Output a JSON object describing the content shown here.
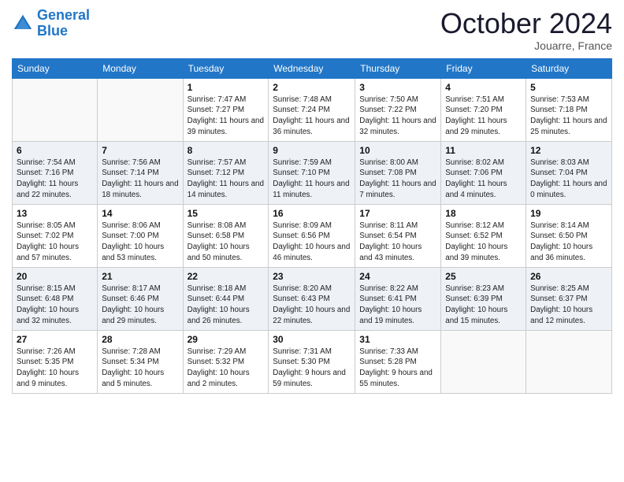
{
  "header": {
    "logo_line1": "General",
    "logo_line2": "Blue",
    "month": "October 2024",
    "location": "Jouarre, France"
  },
  "days_of_week": [
    "Sunday",
    "Monday",
    "Tuesday",
    "Wednesday",
    "Thursday",
    "Friday",
    "Saturday"
  ],
  "weeks": [
    [
      {
        "day": "",
        "sunrise": "",
        "sunset": "",
        "daylight": ""
      },
      {
        "day": "",
        "sunrise": "",
        "sunset": "",
        "daylight": ""
      },
      {
        "day": "1",
        "sunrise": "Sunrise: 7:47 AM",
        "sunset": "Sunset: 7:27 PM",
        "daylight": "Daylight: 11 hours and 39 minutes."
      },
      {
        "day": "2",
        "sunrise": "Sunrise: 7:48 AM",
        "sunset": "Sunset: 7:24 PM",
        "daylight": "Daylight: 11 hours and 36 minutes."
      },
      {
        "day": "3",
        "sunrise": "Sunrise: 7:50 AM",
        "sunset": "Sunset: 7:22 PM",
        "daylight": "Daylight: 11 hours and 32 minutes."
      },
      {
        "day": "4",
        "sunrise": "Sunrise: 7:51 AM",
        "sunset": "Sunset: 7:20 PM",
        "daylight": "Daylight: 11 hours and 29 minutes."
      },
      {
        "day": "5",
        "sunrise": "Sunrise: 7:53 AM",
        "sunset": "Sunset: 7:18 PM",
        "daylight": "Daylight: 11 hours and 25 minutes."
      }
    ],
    [
      {
        "day": "6",
        "sunrise": "Sunrise: 7:54 AM",
        "sunset": "Sunset: 7:16 PM",
        "daylight": "Daylight: 11 hours and 22 minutes."
      },
      {
        "day": "7",
        "sunrise": "Sunrise: 7:56 AM",
        "sunset": "Sunset: 7:14 PM",
        "daylight": "Daylight: 11 hours and 18 minutes."
      },
      {
        "day": "8",
        "sunrise": "Sunrise: 7:57 AM",
        "sunset": "Sunset: 7:12 PM",
        "daylight": "Daylight: 11 hours and 14 minutes."
      },
      {
        "day": "9",
        "sunrise": "Sunrise: 7:59 AM",
        "sunset": "Sunset: 7:10 PM",
        "daylight": "Daylight: 11 hours and 11 minutes."
      },
      {
        "day": "10",
        "sunrise": "Sunrise: 8:00 AM",
        "sunset": "Sunset: 7:08 PM",
        "daylight": "Daylight: 11 hours and 7 minutes."
      },
      {
        "day": "11",
        "sunrise": "Sunrise: 8:02 AM",
        "sunset": "Sunset: 7:06 PM",
        "daylight": "Daylight: 11 hours and 4 minutes."
      },
      {
        "day": "12",
        "sunrise": "Sunrise: 8:03 AM",
        "sunset": "Sunset: 7:04 PM",
        "daylight": "Daylight: 11 hours and 0 minutes."
      }
    ],
    [
      {
        "day": "13",
        "sunrise": "Sunrise: 8:05 AM",
        "sunset": "Sunset: 7:02 PM",
        "daylight": "Daylight: 10 hours and 57 minutes."
      },
      {
        "day": "14",
        "sunrise": "Sunrise: 8:06 AM",
        "sunset": "Sunset: 7:00 PM",
        "daylight": "Daylight: 10 hours and 53 minutes."
      },
      {
        "day": "15",
        "sunrise": "Sunrise: 8:08 AM",
        "sunset": "Sunset: 6:58 PM",
        "daylight": "Daylight: 10 hours and 50 minutes."
      },
      {
        "day": "16",
        "sunrise": "Sunrise: 8:09 AM",
        "sunset": "Sunset: 6:56 PM",
        "daylight": "Daylight: 10 hours and 46 minutes."
      },
      {
        "day": "17",
        "sunrise": "Sunrise: 8:11 AM",
        "sunset": "Sunset: 6:54 PM",
        "daylight": "Daylight: 10 hours and 43 minutes."
      },
      {
        "day": "18",
        "sunrise": "Sunrise: 8:12 AM",
        "sunset": "Sunset: 6:52 PM",
        "daylight": "Daylight: 10 hours and 39 minutes."
      },
      {
        "day": "19",
        "sunrise": "Sunrise: 8:14 AM",
        "sunset": "Sunset: 6:50 PM",
        "daylight": "Daylight: 10 hours and 36 minutes."
      }
    ],
    [
      {
        "day": "20",
        "sunrise": "Sunrise: 8:15 AM",
        "sunset": "Sunset: 6:48 PM",
        "daylight": "Daylight: 10 hours and 32 minutes."
      },
      {
        "day": "21",
        "sunrise": "Sunrise: 8:17 AM",
        "sunset": "Sunset: 6:46 PM",
        "daylight": "Daylight: 10 hours and 29 minutes."
      },
      {
        "day": "22",
        "sunrise": "Sunrise: 8:18 AM",
        "sunset": "Sunset: 6:44 PM",
        "daylight": "Daylight: 10 hours and 26 minutes."
      },
      {
        "day": "23",
        "sunrise": "Sunrise: 8:20 AM",
        "sunset": "Sunset: 6:43 PM",
        "daylight": "Daylight: 10 hours and 22 minutes."
      },
      {
        "day": "24",
        "sunrise": "Sunrise: 8:22 AM",
        "sunset": "Sunset: 6:41 PM",
        "daylight": "Daylight: 10 hours and 19 minutes."
      },
      {
        "day": "25",
        "sunrise": "Sunrise: 8:23 AM",
        "sunset": "Sunset: 6:39 PM",
        "daylight": "Daylight: 10 hours and 15 minutes."
      },
      {
        "day": "26",
        "sunrise": "Sunrise: 8:25 AM",
        "sunset": "Sunset: 6:37 PM",
        "daylight": "Daylight: 10 hours and 12 minutes."
      }
    ],
    [
      {
        "day": "27",
        "sunrise": "Sunrise: 7:26 AM",
        "sunset": "Sunset: 5:35 PM",
        "daylight": "Daylight: 10 hours and 9 minutes."
      },
      {
        "day": "28",
        "sunrise": "Sunrise: 7:28 AM",
        "sunset": "Sunset: 5:34 PM",
        "daylight": "Daylight: 10 hours and 5 minutes."
      },
      {
        "day": "29",
        "sunrise": "Sunrise: 7:29 AM",
        "sunset": "Sunset: 5:32 PM",
        "daylight": "Daylight: 10 hours and 2 minutes."
      },
      {
        "day": "30",
        "sunrise": "Sunrise: 7:31 AM",
        "sunset": "Sunset: 5:30 PM",
        "daylight": "Daylight: 9 hours and 59 minutes."
      },
      {
        "day": "31",
        "sunrise": "Sunrise: 7:33 AM",
        "sunset": "Sunset: 5:28 PM",
        "daylight": "Daylight: 9 hours and 55 minutes."
      },
      {
        "day": "",
        "sunrise": "",
        "sunset": "",
        "daylight": ""
      },
      {
        "day": "",
        "sunrise": "",
        "sunset": "",
        "daylight": ""
      }
    ]
  ]
}
